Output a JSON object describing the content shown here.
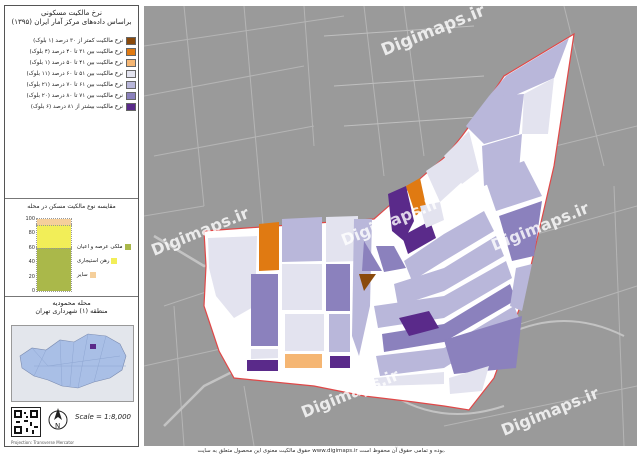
{
  "sidebar": {
    "title_line1": "نرخ مالکیت مسکونی",
    "title_line2": "براساس داده‌های مرکز آمار ایران (۱۳۹۵)",
    "legend": [
      {
        "label": "نرخ مالکیت کمتر از ۳۰ درصد (۱ بلوک)",
        "color": "#8a4a0c"
      },
      {
        "label": "نرخ مالکیت بین ۳۱ تا ۴۰ درصد (۴ بلوک)",
        "color": "#e07a12"
      },
      {
        "label": "نرخ مالکیت بین ۴۱ تا ۵۰ درصد (۱ بلوک)",
        "color": "#f5b673"
      },
      {
        "label": "نرخ مالکیت بین ۵۱ تا ۶۰ درصد (۱۱ بلوک)",
        "color": "#e3e3ef"
      },
      {
        "label": "نرخ مالکیت بین ۶۱ تا ۷۰ درصد (۲۱ بلوک)",
        "color": "#b9b7da"
      },
      {
        "label": "نرخ مالکیت بین ۷۱ تا ۸۰ درصد (۲۰ بلوک)",
        "color": "#8b81bd"
      },
      {
        "label": "نرخ مالکیت بیشتر از ۸۱ درصد (۶ بلوک)",
        "color": "#5a2a8a"
      }
    ],
    "chart_title": "مقایسه نوع مالکیت مسکن در محله",
    "area_line1": "محله محمودیه",
    "area_line2": "منطقه (۱) شهرداری تهران",
    "scale": "Scale = 1:8,000",
    "footer": "Projection: Transverse Mercator"
  },
  "chart_data": {
    "type": "bar",
    "categories": [
      "محله"
    ],
    "series": [
      {
        "name": "ملکی عرصه و اعیان",
        "color": "#aab84a",
        "values": [
          60
        ]
      },
      {
        "name": "رهن استیجاری",
        "color": "#f2ee58",
        "values": [
          32
        ]
      },
      {
        "name": "سایر",
        "color": "#f5cf9b",
        "values": [
          8
        ]
      }
    ],
    "tick_labels": [
      "100",
      "80",
      "60",
      "40",
      "20",
      "0"
    ]
  },
  "map": {
    "watermark": "Digimaps.ir",
    "colors": {
      "background": "#9a9a9a",
      "boundary": "#e04848",
      "street_fill": "#ffffff"
    }
  },
  "copyright": "حقوق مالکیت معنوی این محصول متعلق به سایت www.digimaps.ir بوده و تمامی حقوق آن محفوظ است."
}
